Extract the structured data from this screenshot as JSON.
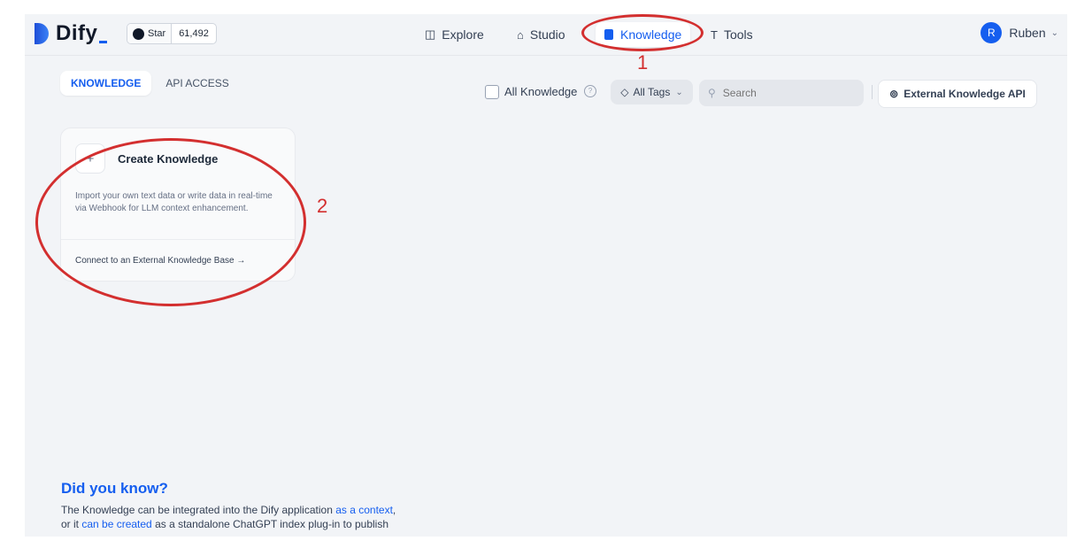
{
  "header": {
    "brand": "Dify",
    "github": {
      "star_label": "Star",
      "count": "61,492"
    },
    "nav": [
      {
        "label": "Explore",
        "icon": "compass-icon"
      },
      {
        "label": "Studio",
        "icon": "robot-icon"
      },
      {
        "label": "Knowledge",
        "icon": "book-icon",
        "active": true
      },
      {
        "label": "Tools",
        "icon": "tools-icon"
      }
    ],
    "user": {
      "initial": "R",
      "name": "Ruben"
    }
  },
  "tabs": [
    {
      "label": "KNOWLEDGE",
      "active": true
    },
    {
      "label": "API ACCESS"
    }
  ],
  "toolbar": {
    "all_knowledge_label": "All Knowledge",
    "tags_label": "All Tags",
    "search_placeholder": "Search",
    "external_api_label": "External Knowledge API"
  },
  "create_card": {
    "plus": "+",
    "title": "Create Knowledge",
    "description": "Import your own text data or write data in real-time via Webhook for LLM context enhancement.",
    "external_link": "Connect to an External Knowledge Base →"
  },
  "annotations": {
    "one": "1",
    "two": "2"
  },
  "did_you_know": {
    "title": "Did you know?",
    "line1_prefix": "The Knowledge can be integrated into the Dify application ",
    "line1_link": "as a context",
    "line1_suffix": ",",
    "line2_prefix": "or it ",
    "line2_link": "can be created",
    "line2_suffix": " as a standalone ChatGPT index plug-in to publish"
  },
  "colors": {
    "accent": "#155eef",
    "annotation": "#d32f2f",
    "background": "#f2f4f7"
  }
}
